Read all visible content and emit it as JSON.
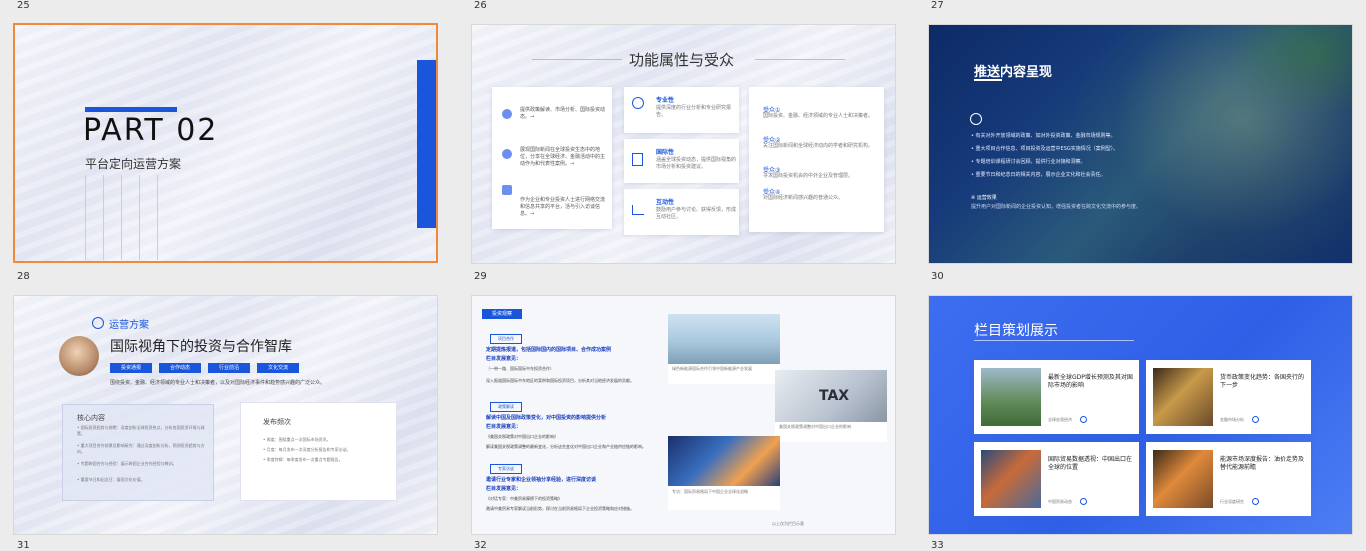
{
  "slide_numbers": [
    "25",
    "26",
    "27",
    "28",
    "29",
    "30",
    "31",
    "32",
    "33"
  ],
  "s28": {
    "part": "PART 02",
    "subtitle": "平台定向运营方案"
  },
  "s29": {
    "title": "功能属性与受众",
    "left_items": [
      "提供政策解读、市场分析、国际投资动态。→",
      "展现国际新闻在全球投资生态中的地位，分享在全球经济、金融活动中的主动作为和代表性案例。→",
      "作为企业和专业投资人士进行网络交流和信息共享的平台，活与引入访谈信息。→"
    ],
    "mid_items": [
      {
        "title": "专业性",
        "text": "提供深度的行业分析和专业研究报告。"
      },
      {
        "title": "国际性",
        "text": "涵盖全球投资动态，提供国际视角的市场分析和投资建议。"
      },
      {
        "title": "互动性",
        "text": "鼓励用户参与讨论、获得反馈，形成互动社区。"
      }
    ],
    "right_items": [
      {
        "title": "受众①",
        "text": "国际投资、金融、经济领域的专业人士和决策者。"
      },
      {
        "title": "受众②",
        "text": "关注国际新闻和全球经济动向的学者和研究机构。"
      },
      {
        "title": "受众③",
        "text": "寻求国际投资机会的中外企业及管理层。"
      },
      {
        "title": "受众④",
        "text": "对国际经济新闻感兴趣的普通公众。"
      }
    ]
  },
  "s30": {
    "title": "推送内容呈现",
    "bullets": [
      "有关对外开放领域的政策、如对外投资政策、金融市场规则等。",
      "重大项目合作信息、项目投资及运营中ESG实施情况（案例型）。",
      "专题培训课程研讨会回顾，提供行业对接和洞察。",
      "重要节日和纪念日的相关内容，展示企业文化和社会责任。"
    ],
    "footnote_title": "※ 运营效果",
    "footnote": "提升用户对国际新闻的企业投资认知，增强投资者在跨文化交流中的参与度。"
  },
  "s31": {
    "tag": "运营方案",
    "title": "国际视角下的投资与合作智库",
    "buttons": [
      "投资通报",
      "合作动态",
      "行业前沿",
      "文化交流"
    ],
    "desc": "围绕投资、金融、经济领域的专业人士和决策者，以及对国际经济事件和趋势感兴趣的广泛公众。",
    "left_title": "核心内容",
    "left_items": [
      "国际投资趋势与前瞻：深度剖析全球投资热点，分析各国投资环境与政策。",
      "重大项目合作前景及影响研究：通过深度剖析分析，预测投资趋势与方向。",
      "专题跨国合作与经验：展示跨国企业合作经验与教训。",
      "重要节日和纪念日：展现文化价值。"
    ],
    "right_title": "发布频次",
    "right_items": [
      "周度：围绕重点一次国际市场资讯。",
      "月度：每月发布一次深度分析报告和专家访谈。",
      "季度特辑：每季度发布一次重点专题报告。"
    ]
  },
  "s32": {
    "tag": "投资观察",
    "sections": [
      {
        "label": "项目合作",
        "title": "定期提炼报道，包括国际国内的国际项目、合作成功案例",
        "sub": "栏目发展意见：",
        "lines": [
          "（一带一路、国际国际中东投资合作）",
          "深入报道国际国际中东地区的案例和国际投资项目，分析其对当地经济发展的贡献。"
        ]
      },
      {
        "label": "政策解读",
        "title": "解读中国及国际政策变化，对中国投资的影响提供分析",
        "sub": "栏目发展意见：",
        "lines": [
          "《美国关税政策对中国出口企业的影响》",
          "解读美国关税政策调整的最新变化，分析这些变化对中国出口企业和产业链供应链的影响。"
        ]
      },
      {
        "label": "专家访谈",
        "title": "邀请行业专家和企业领袖分享经验，进行深度访谈",
        "sub": "栏目发展意见：",
        "lines": [
          "《对话专家：中美贸易摩擦下的投资策略》",
          "邀请中美贸易专家解读当前形势，探讨在当前贸易格局下企业投资策略和应对措施。"
        ]
      }
    ],
    "captions": [
      "绿色新能源国际合作引领中国新能源产业发展",
      "美国关税政策调整对中国出口企业的影响",
      "专访：国际贸易格局下中国企业全球化战略",
      "以上仅为栏目示意"
    ]
  },
  "s33": {
    "title": "栏目策划展示",
    "cards": [
      {
        "title": "最新全球GDP增长预测及其对国际市场的影响",
        "tag": "全球宏观经济"
      },
      {
        "title": "货币政策变化趋势：各国央行的下一步",
        "tag": "金融市场分析"
      },
      {
        "title": "国际贸易数据透视：中国出口在全球的位置",
        "tag": "中国贸易动态"
      },
      {
        "title": "能源市场深度报告：油价走势及替代能源前瞻",
        "tag": "行业深度研究"
      }
    ]
  }
}
